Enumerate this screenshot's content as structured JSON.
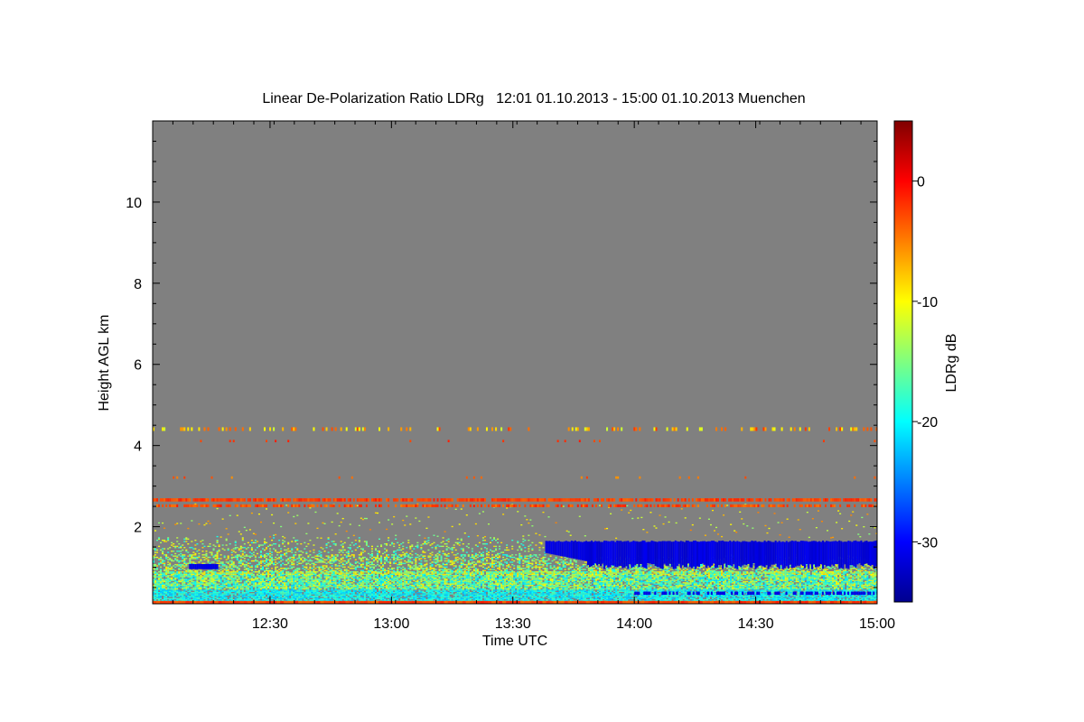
{
  "chart_data": {
    "type": "heatmap",
    "title": "Linear De-Polarization Ratio LDRg   12:01 01.10.2013 - 15:00 01.10.2013 Muenchen",
    "xlabel": "Time UTC",
    "ylabel": "Height AGL km",
    "colorbar_label": "LDRg dB",
    "x_range_minutes_utc": [
      721,
      900
    ],
    "xlim_utc": [
      "12:01",
      "15:00"
    ],
    "x_ticks": [
      {
        "minute": 750,
        "label": "12:30"
      },
      {
        "minute": 780,
        "label": "13:00"
      },
      {
        "minute": 810,
        "label": "13:30"
      },
      {
        "minute": 840,
        "label": "14:00"
      },
      {
        "minute": 870,
        "label": "14:30"
      },
      {
        "minute": 900,
        "label": "15:00"
      }
    ],
    "ylim_km": [
      0.1,
      12.0
    ],
    "y_ticks": [
      {
        "value": 2,
        "label": "2"
      },
      {
        "value": 4,
        "label": "4"
      },
      {
        "value": 6,
        "label": "6"
      },
      {
        "value": 8,
        "label": "8"
      },
      {
        "value": 10,
        "label": "10"
      }
    ],
    "colorbar_range_db": [
      -35,
      5
    ],
    "colorbar_ticks": [
      {
        "value": 0,
        "label": "0"
      },
      {
        "value": -10,
        "label": "-10"
      },
      {
        "value": -20,
        "label": "-20"
      },
      {
        "value": -30,
        "label": "-30"
      }
    ],
    "no_data_color": "#808080",
    "colormap": "jet",
    "layers": [
      {
        "name": "aerosol boundary layer",
        "t_start": 721,
        "t_end": 900,
        "h_bottom": 0.15,
        "h_top": 1.7,
        "ldr_db_range": [
          -25,
          -10
        ]
      },
      {
        "name": "near-surface layer",
        "t_start": 721,
        "t_end": 900,
        "h_bottom": 0.15,
        "h_top": 0.45,
        "ldr_db_range": [
          -24,
          -18
        ]
      },
      {
        "name": "depolarizing cloud",
        "t_start": 818,
        "t_end": 900,
        "h_bottom": 1.0,
        "h_top": 1.65,
        "ldr_db_typical": -32
      },
      {
        "name": "elevated band",
        "t_start": 721,
        "t_end": 900,
        "h_bottom": 2.45,
        "h_top": 2.7,
        "ldr_db_range": [
          -5,
          -1
        ]
      },
      {
        "name": "sparse echoes",
        "t_start": 721,
        "t_end": 900,
        "h_bottom": 4.35,
        "h_top": 4.45,
        "ldr_db_range": [
          -12,
          -3
        ]
      }
    ]
  }
}
